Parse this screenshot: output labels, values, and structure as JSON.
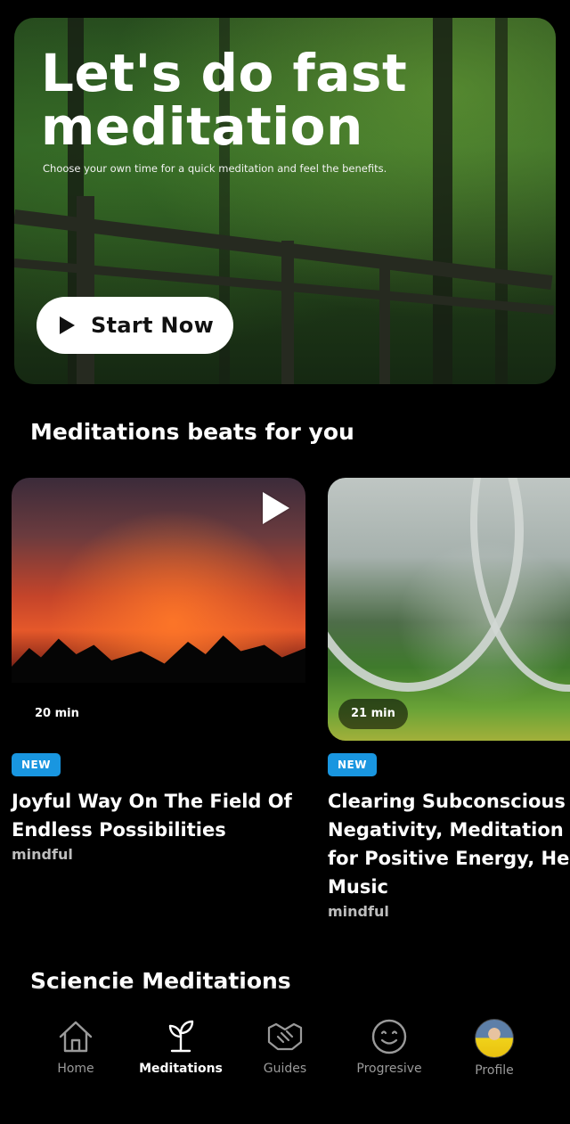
{
  "hero": {
    "title_line1": "Let's do fast",
    "title_line2": "meditation",
    "subtitle": "Choose your own time for a quick meditation and feel the benefits.",
    "start_button_label": "Start Now"
  },
  "section_beats": {
    "title": "Meditations beats for you"
  },
  "cards": [
    {
      "duration": "20 min",
      "badge": "NEW",
      "title_line1": "Joyful Way On The Field Of",
      "title_line2": "Endless Possibilities",
      "category": "mindful"
    },
    {
      "duration": "21 min",
      "badge": "NEW",
      "title_line1": "Clearing Subconscious",
      "title_line2": "Negativity, Meditation M",
      "title_line3": "for Positive Energy, Heal",
      "title_line4": "Music",
      "category": "mindful"
    }
  ],
  "section_science": {
    "title": "Sciencie Meditations"
  },
  "nav": {
    "items": [
      {
        "label": "Home",
        "icon": "home-icon"
      },
      {
        "label": "Meditations",
        "icon": "sprout-icon",
        "active": true
      },
      {
        "label": "Guides",
        "icon": "handshake-icon"
      },
      {
        "label": "Progresive",
        "icon": "smile-icon"
      },
      {
        "label": "Profile",
        "icon": "avatar"
      }
    ]
  },
  "colors": {
    "background": "#000000",
    "badge": "#1996E0",
    "nav_inactive": "#9A9A9A",
    "nav_active": "#FFFFFF"
  }
}
